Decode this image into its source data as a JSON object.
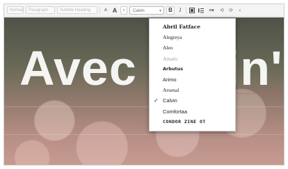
{
  "toolbar": {
    "slot1": "Normal",
    "slot2": "Paragraph",
    "slot3": "Subtitle Heading",
    "font_size_down": "A",
    "font_size_up": "A",
    "font_selected": "Calvin",
    "bold": "B",
    "italic": "I",
    "image_icon": "image-icon",
    "list_icon": "list-icon",
    "align_icon": "align-icon",
    "undo_icon": "undo-icon",
    "redo_icon": "redo-icon",
    "back_icon": "chevron-left-icon"
  },
  "canvas": {
    "headline": "Avec",
    "headline_tail": "in'"
  },
  "font_menu": {
    "items": [
      {
        "label": "Abril Fatface",
        "checked": false
      },
      {
        "label": "Alegreya",
        "checked": false
      },
      {
        "label": "Aleo",
        "checked": false
      },
      {
        "label": "Amatic",
        "checked": false
      },
      {
        "label": "Arbutus",
        "checked": false
      },
      {
        "label": "Arimo",
        "checked": false
      },
      {
        "label": "Arsenal",
        "checked": false
      },
      {
        "label": "Calvin",
        "checked": true
      },
      {
        "label": "Comfortaa",
        "checked": false
      },
      {
        "label": "CONDOR ZINE OT",
        "checked": false
      }
    ],
    "check_glyph": "✓"
  },
  "colors": {
    "menu_bg": "#ffffff",
    "toolbar_bg": "#f4f4f4",
    "headline": "#ffffff",
    "guide_line": "#dc5046"
  }
}
